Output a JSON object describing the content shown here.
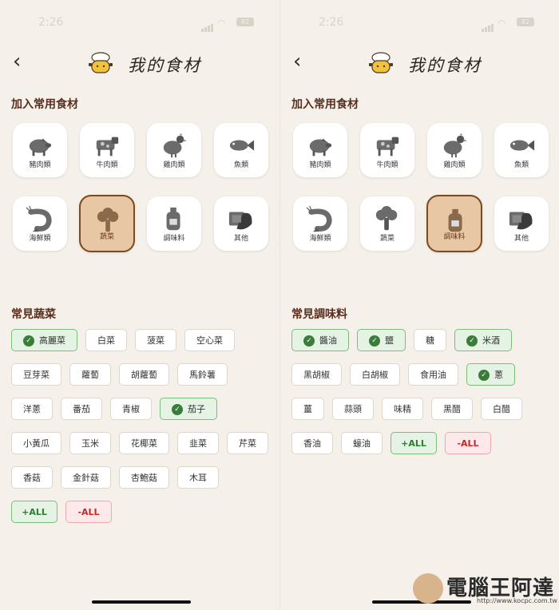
{
  "status": {
    "time": "2:26",
    "battery": "82"
  },
  "title": "我的食材",
  "add_section": "加入常用食材",
  "categories": [
    "豬肉類",
    "牛肉類",
    "雞肉類",
    "魚類",
    "海鮮類",
    "蔬菜",
    "調味料",
    "其他"
  ],
  "left": {
    "selected_category": "蔬菜",
    "common_title": "常見蔬菜",
    "chips": [
      {
        "label": "高麗菜",
        "on": true
      },
      {
        "label": "白菜",
        "on": false
      },
      {
        "label": "菠菜",
        "on": false
      },
      {
        "label": "空心菜",
        "on": false
      },
      {
        "label": "豆芽菜",
        "on": false
      },
      {
        "label": "蘿蔔",
        "on": false
      },
      {
        "label": "胡蘿蔔",
        "on": false
      },
      {
        "label": "馬鈴薯",
        "on": false
      },
      {
        "label": "洋蔥",
        "on": false
      },
      {
        "label": "番茄",
        "on": false
      },
      {
        "label": "青椒",
        "on": false
      },
      {
        "label": "茄子",
        "on": true
      },
      {
        "label": "小黃瓜",
        "on": false
      },
      {
        "label": "玉米",
        "on": false
      },
      {
        "label": "花椰菜",
        "on": false
      },
      {
        "label": "韭菜",
        "on": false
      },
      {
        "label": "芹菜",
        "on": false
      },
      {
        "label": "香菇",
        "on": false
      },
      {
        "label": "金針菇",
        "on": false
      },
      {
        "label": "杏鮑菇",
        "on": false
      },
      {
        "label": "木耳",
        "on": false
      }
    ],
    "add_all": "+ALL",
    "remove_all": "-ALL"
  },
  "right": {
    "selected_category": "調味料",
    "common_title": "常見調味料",
    "chips": [
      {
        "label": "醬油",
        "on": true
      },
      {
        "label": "鹽",
        "on": true
      },
      {
        "label": "糖",
        "on": false
      },
      {
        "label": "米酒",
        "on": true
      },
      {
        "label": "黑胡椒",
        "on": false
      },
      {
        "label": "白胡椒",
        "on": false
      },
      {
        "label": "食用油",
        "on": false
      },
      {
        "label": "蔥",
        "on": true
      },
      {
        "label": "薑",
        "on": false
      },
      {
        "label": "蒜頭",
        "on": false
      },
      {
        "label": "味精",
        "on": false
      },
      {
        "label": "黑醋",
        "on": false
      },
      {
        "label": "白醋",
        "on": false
      },
      {
        "label": "香油",
        "on": false
      },
      {
        "label": "蠔油",
        "on": false
      }
    ],
    "add_all": "+ALL",
    "remove_all": "-ALL"
  },
  "watermark": {
    "text": "電腦王阿達",
    "url": "http://www.kocpc.com.tw"
  },
  "colors": {
    "background": "#f5f1ea",
    "selected_tile": "#e8c8a4",
    "chip_on": "#e4f3e4",
    "chip_remove": "#fde8ea"
  }
}
